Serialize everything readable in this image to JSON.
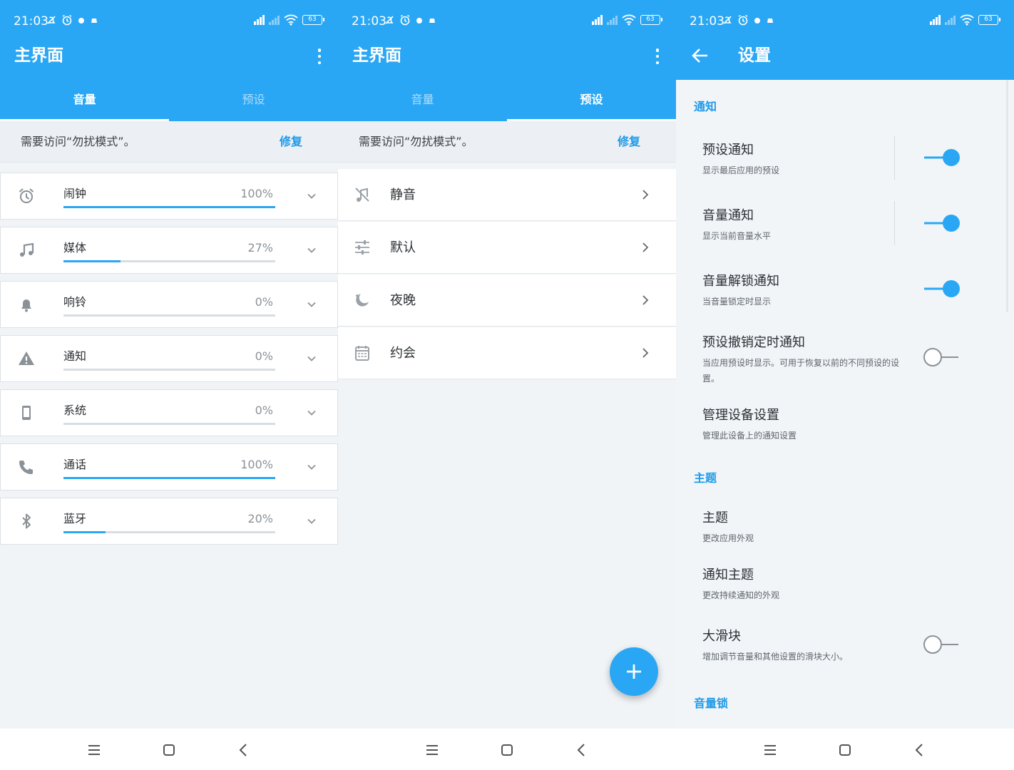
{
  "status": {
    "time": "21:03",
    "battery": "63",
    "network": "HD"
  },
  "main": {
    "title": "主界面",
    "tabs": [
      {
        "label": "音量"
      },
      {
        "label": "预设"
      }
    ],
    "banner": {
      "text": "需要访问“勿扰模式”。",
      "action": "修复"
    }
  },
  "volumes": [
    {
      "label": "闹钟",
      "percent": "100%",
      "level": 100,
      "icon": "alarm-icon"
    },
    {
      "label": "媒体",
      "percent": "27%",
      "level": 27,
      "icon": "music-note-icon"
    },
    {
      "label": "响铃",
      "percent": "0%",
      "level": 0,
      "icon": "bell-icon"
    },
    {
      "label": "通知",
      "percent": "0%",
      "level": 0,
      "icon": "warning-icon"
    },
    {
      "label": "系统",
      "percent": "0%",
      "level": 0,
      "icon": "phone-device-icon"
    },
    {
      "label": "通话",
      "percent": "100%",
      "level": 100,
      "icon": "call-icon"
    },
    {
      "label": "蓝牙",
      "percent": "20%",
      "level": 20,
      "icon": "bluetooth-icon"
    }
  ],
  "presets": [
    {
      "label": "静音",
      "icon": "mute-icon"
    },
    {
      "label": "默认",
      "icon": "sliders-icon"
    },
    {
      "label": "夜晚",
      "icon": "night-icon"
    },
    {
      "label": "约会",
      "icon": "calendar-icon"
    }
  ],
  "settings": {
    "title": "设置",
    "sections": {
      "notifications": "通知",
      "theme": "主题",
      "volume_lock": "音量锁"
    },
    "items": [
      {
        "title": "预设通知",
        "subtitle": "显示最后应用的预设",
        "toggle": "on"
      },
      {
        "title": "音量通知",
        "subtitle": "显示当前音量水平",
        "toggle": "on"
      },
      {
        "title": "音量解锁通知",
        "subtitle": "当音量锁定时显示",
        "toggle": "on"
      },
      {
        "title": "预设撤销定时通知",
        "subtitle": "当应用预设时显示。可用于恢复以前的不同预设的设置。",
        "toggle": "off"
      },
      {
        "title": "管理设备设置",
        "subtitle": "管理此设备上的通知设置"
      },
      {
        "title": "主题",
        "subtitle": "更改应用外观"
      },
      {
        "title": "通知主题",
        "subtitle": "更改持续通知的外观"
      },
      {
        "title": "大滑块",
        "subtitle": "增加调节音量和其他设置的滑块大小。",
        "toggle": "off"
      }
    ]
  },
  "colors": {
    "primary": "#2aa7f4",
    "accent": "#1f9be9",
    "track": "#d8dde1"
  }
}
